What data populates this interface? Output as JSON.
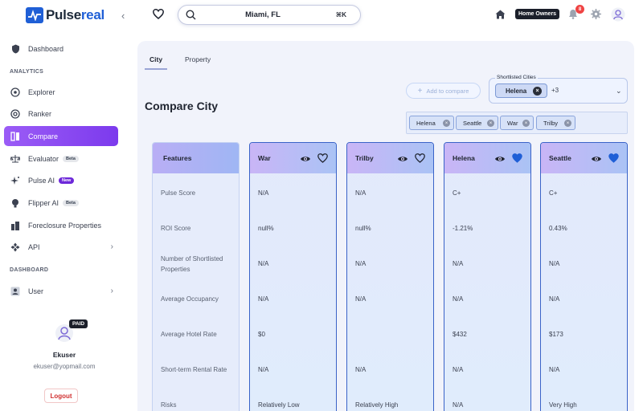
{
  "brand": {
    "logo_prefix": "Pulse",
    "logo_accent": "real"
  },
  "header": {
    "search_text": "Miami, FL",
    "search_shortcut": "⌘K",
    "home_owners_label": "Home Owners",
    "notification_count": "8"
  },
  "sidebar": {
    "dashboard": "Dashboard",
    "section_analytics": "ANALYTICS",
    "explorer": "Explorer",
    "ranker": "Ranker",
    "compare": "Compare",
    "evaluator": "Evaluator",
    "evaluator_badge": "Beta",
    "pulse_ai": "Pulse AI",
    "pulse_ai_badge": "New",
    "flipper_ai": "Flipper AI",
    "flipper_ai_badge": "Beta",
    "foreclosure": "Foreclosure Properties",
    "api": "API",
    "section_dashboard": "DASHBOARD",
    "user": "User"
  },
  "profile": {
    "plan_badge": "PAID",
    "name": "Ekuser",
    "email": "ekuser@yopmail.com",
    "logout_label": "Logout"
  },
  "tabs": {
    "city": "City",
    "property": "Property"
  },
  "page_title": "Compare City",
  "add_to_compare": "Add to compare",
  "shortlist": {
    "label": "Shortlisted Cities",
    "selected": "Helena",
    "more": "+3"
  },
  "compare_chips": [
    "Helena",
    "Seattle",
    "War",
    "Trilby"
  ],
  "features": {
    "header": "Features",
    "rows": [
      "Pulse Score",
      "ROI Score",
      "Number of Shortlisted Properties",
      "Average Occupancy",
      "Average Hotel Rate",
      "Short-term Rental Rate",
      "Risks"
    ]
  },
  "cities": [
    {
      "name": "War",
      "favorited": false,
      "values": [
        "N/A",
        "null%",
        "N/A",
        "N/A",
        "$0",
        "N/A",
        "Relatively Low"
      ]
    },
    {
      "name": "Trilby",
      "favorited": false,
      "values": [
        "N/A",
        "null%",
        "N/A",
        "N/A",
        "",
        "N/A",
        "Relatively High"
      ]
    },
    {
      "name": "Helena",
      "favorited": true,
      "values": [
        "C+",
        "-1.21%",
        "N/A",
        "N/A",
        "$432",
        "N/A",
        "N/A"
      ]
    },
    {
      "name": "Seattle",
      "favorited": true,
      "values": [
        "C+",
        "0.43%",
        "N/A",
        "N/A",
        "$173",
        "N/A",
        "Very High"
      ]
    }
  ],
  "colors": {
    "accent": "#7c3aed",
    "brand_blue": "#1f5fd6",
    "column_border": "#3a63c8",
    "favorite_heart": "#1f5fd6"
  }
}
